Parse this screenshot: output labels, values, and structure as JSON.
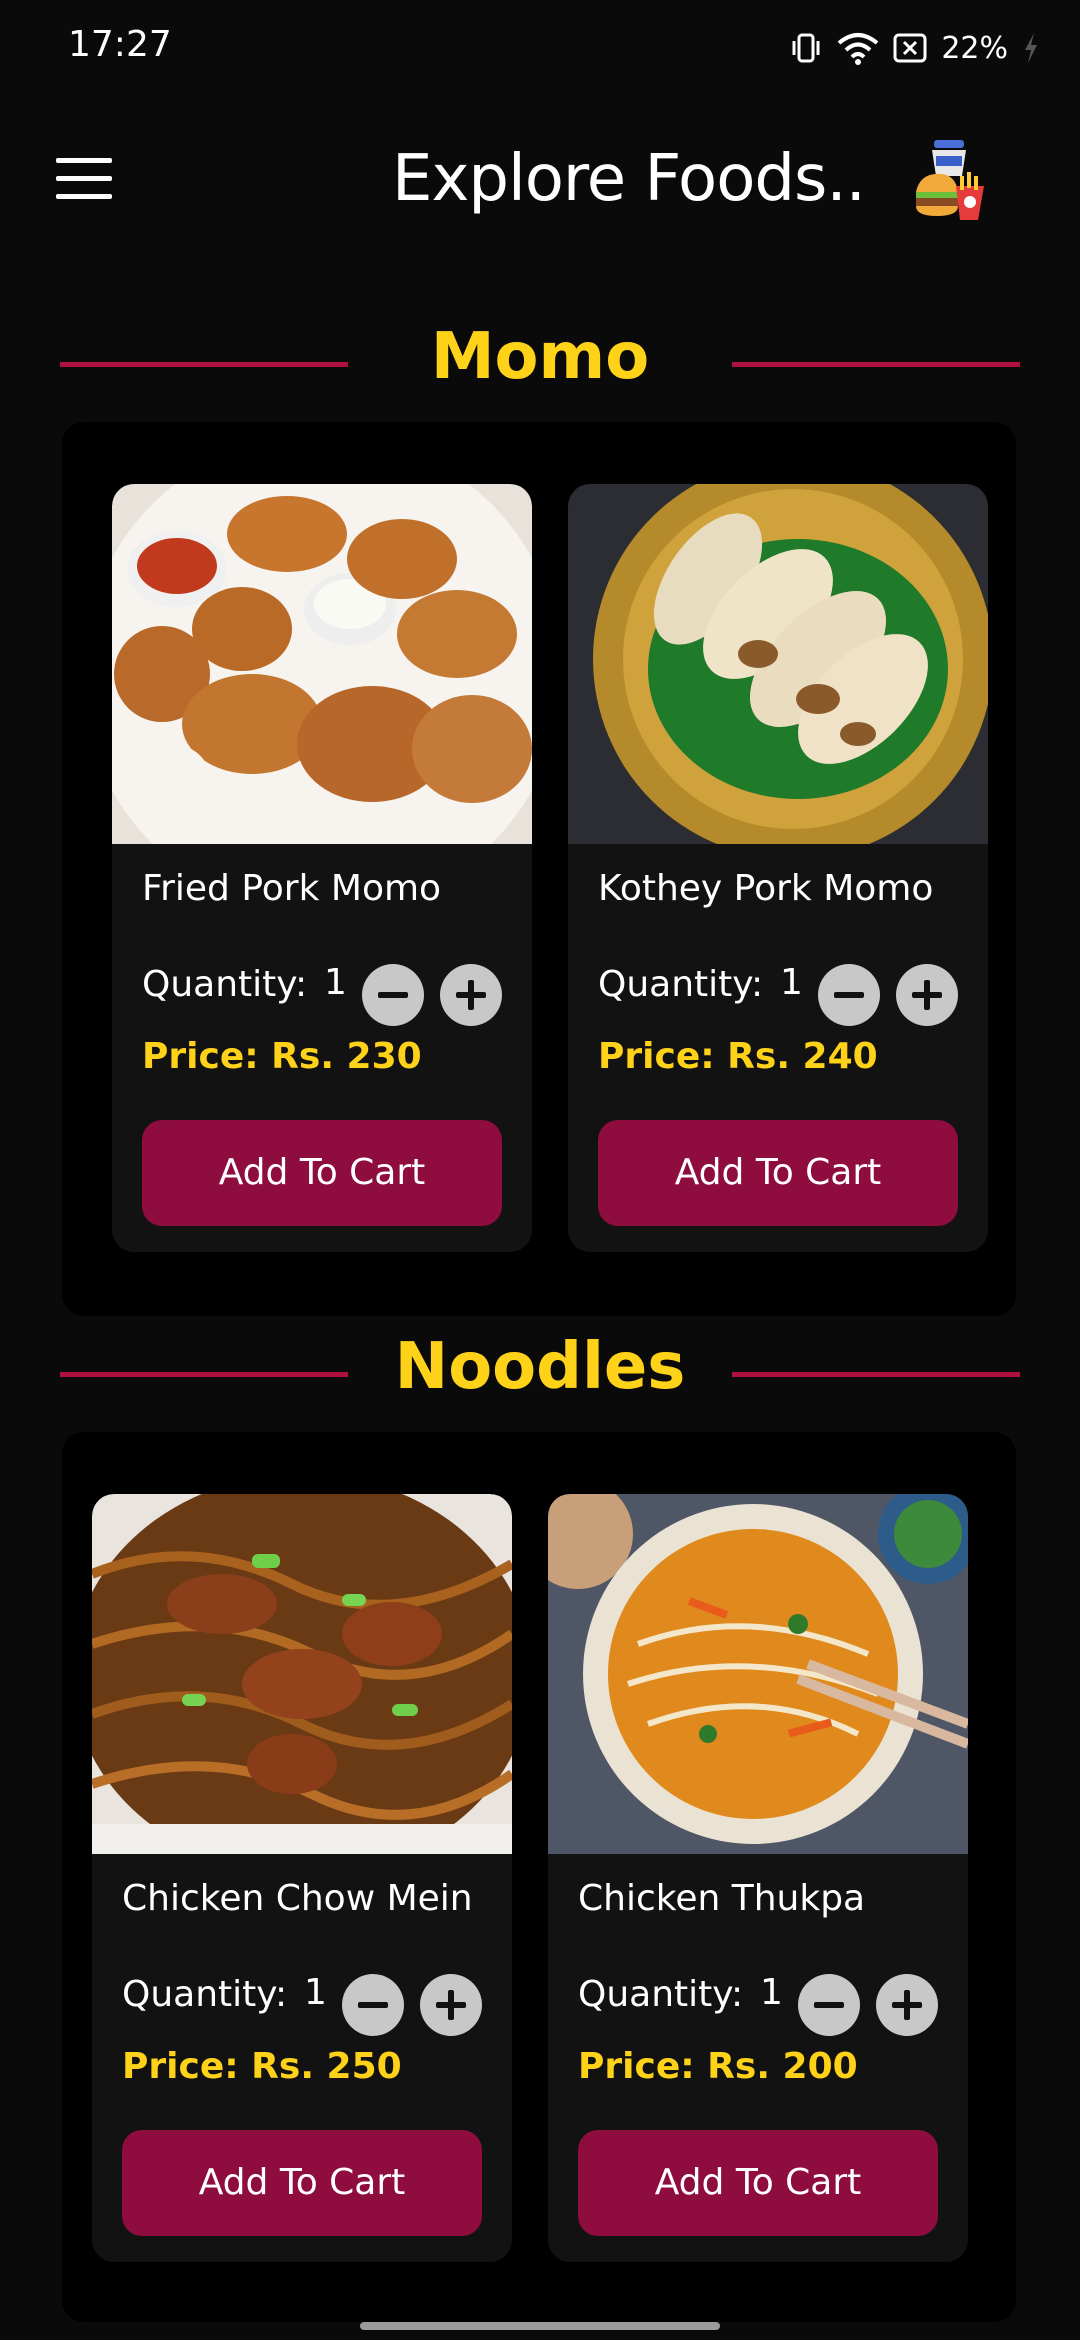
{
  "status_bar": {
    "time": "17:27",
    "battery": "22%"
  },
  "app_bar": {
    "title": "Explore Foods..",
    "menu_icon": "hamburger-menu-icon",
    "cart_icon": "food-cart-icon"
  },
  "sections": [
    {
      "title": "Momo",
      "items": [
        {
          "name": "Fried Pork Momo",
          "quantity_label": "Quantity:",
          "quantity": "1",
          "price": "Price:  Rs. 230",
          "button": "Add To Cart"
        },
        {
          "name": "Kothey Pork Momo",
          "quantity_label": "Quantity:",
          "quantity": "1",
          "price": "Price:  Rs. 240",
          "button": "Add To Cart"
        }
      ]
    },
    {
      "title": "Noodles",
      "items": [
        {
          "name": "Chicken Chow Mein",
          "quantity_label": "Quantity:",
          "quantity": "1",
          "price": "Price:  Rs. 250",
          "button": "Add To Cart"
        },
        {
          "name": "Chicken Thukpa",
          "quantity_label": "Quantity:",
          "quantity": "1",
          "price": "Price:  Rs. 200",
          "button": "Add To Cart"
        }
      ]
    }
  ],
  "colors": {
    "accent_yellow": "#ffd21a",
    "button": "#8e0c3e",
    "divider": "#b01040",
    "background": "#0a0a0a"
  }
}
